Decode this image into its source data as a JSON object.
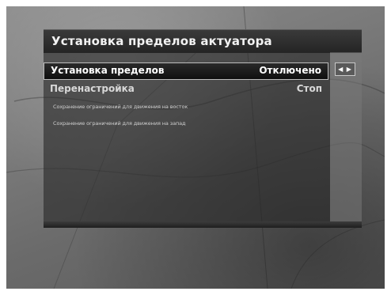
{
  "panel": {
    "title": "Установка пределов актуатора"
  },
  "menu": {
    "items": [
      {
        "label": "Установка пределов",
        "value": "Отключено",
        "selected": true
      },
      {
        "label": "Перенастройка",
        "value": "Стоп",
        "selected": false
      }
    ],
    "hints": [
      "Сохранение ограничений для движения на восток",
      "Сохранение ограничений для движения на запад"
    ]
  },
  "nav_arrows": {
    "icon": "left-right-arrows-icon",
    "glyph": "◀ ▶"
  },
  "colors": {
    "selected_bar": "#0f0f0f",
    "selected_border": "#bdbdbd",
    "panel_bg": "#282828"
  }
}
